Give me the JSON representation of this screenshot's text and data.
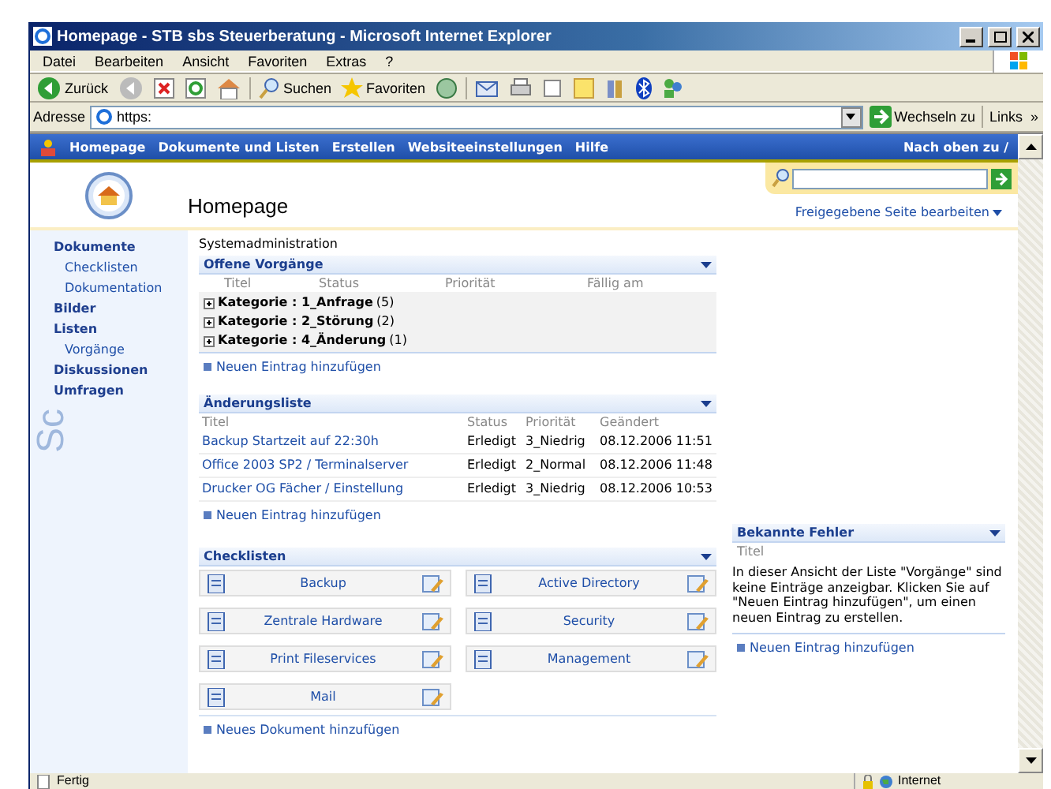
{
  "window": {
    "title": "Homepage - STB sbs Steuerberatung - Microsoft Internet Explorer"
  },
  "menu": [
    "Datei",
    "Bearbeiten",
    "Ansicht",
    "Favoriten",
    "Extras",
    "?"
  ],
  "toolbar": {
    "back": "Zurück",
    "search": "Suchen",
    "favorites": "Favoriten"
  },
  "address": {
    "label": "Adresse",
    "value": "https:",
    "go": "Wechseln zu",
    "links": "Links",
    "more": "»"
  },
  "nav": {
    "items": [
      "Homepage",
      "Dokumente und Listen",
      "Erstellen",
      "Websiteeinstellungen",
      "Hilfe"
    ],
    "right": "Nach oben zu /"
  },
  "header": {
    "title": "Homepage",
    "edit_link": "Freigegebene Seite bearbeiten"
  },
  "sidebar": {
    "watermark": "Sc",
    "items": [
      {
        "label": "Dokumente",
        "children": [
          {
            "label": "Checklisten"
          },
          {
            "label": "Dokumentation"
          }
        ]
      },
      {
        "label": "Bilder"
      },
      {
        "label": "Listen",
        "children": [
          {
            "label": "Vorgänge"
          }
        ]
      },
      {
        "label": "Diskussionen"
      },
      {
        "label": "Umfragen"
      }
    ]
  },
  "breadcrumb": "Systemadministration",
  "open_tasks": {
    "title": "Offene Vorgänge",
    "columns": [
      "Titel",
      "Status",
      "Priorität",
      "Fällig am"
    ],
    "groups": [
      {
        "label": "Kategorie : 1_Anfrage",
        "count": "(5)"
      },
      {
        "label": "Kategorie : 2_Störung",
        "count": "(2)"
      },
      {
        "label": "Kategorie : 4_Änderung",
        "count": "(1)"
      }
    ],
    "add_link": "Neuen Eintrag hinzufügen"
  },
  "changes": {
    "title": "Änderungsliste",
    "columns": [
      "Titel",
      "Status",
      "Priorität",
      "Geändert"
    ],
    "rows": [
      [
        "Backup Startzeit auf 22:30h",
        "Erledigt",
        "3_Niedrig",
        "08.12.2006 11:51"
      ],
      [
        "Office 2003 SP2 / Terminalserver",
        "Erledigt",
        "2_Normal",
        "08.12.2006 11:48"
      ],
      [
        "Drucker OG Fächer / Einstellung",
        "Erledigt",
        "3_Niedrig",
        "08.12.2006 10:53"
      ]
    ],
    "add_link": "Neuen Eintrag hinzufügen"
  },
  "checklists": {
    "title": "Checklisten",
    "items": [
      "Backup",
      "Active Directory",
      "Zentrale Hardware",
      "Security",
      "Print Fileservices",
      "Management",
      "Mail"
    ],
    "add_link": "Neues Dokument hinzufügen"
  },
  "known_errors": {
    "title": "Bekannte Fehler",
    "column": "Titel",
    "message": "In dieser Ansicht der Liste \"Vorgänge\" sind keine Einträge anzeigbar. Klicken Sie auf \"Neuen Eintrag hinzufügen\", um einen neuen Eintrag zu erstellen.",
    "add_link": "Neuen Eintrag hinzufügen"
  },
  "status_bar": {
    "text": "Fertig",
    "zone": "Internet"
  }
}
